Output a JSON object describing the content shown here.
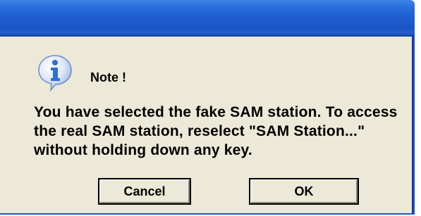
{
  "dialog": {
    "heading": "Note !",
    "message": "You have selected the fake SAM station.  To access the real SAM station, reselect \"SAM Station...\" without holding down any key.",
    "icon": "information-icon"
  },
  "buttons": {
    "cancel": "Cancel",
    "ok": "OK"
  },
  "colors": {
    "titlebar": "#1f5fd3",
    "dialog_background": "#ece9d8",
    "info_icon": "#2f6fd6"
  }
}
